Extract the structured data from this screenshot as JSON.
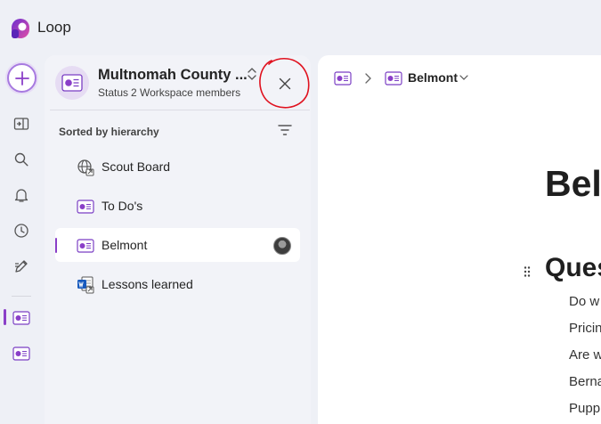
{
  "app": {
    "title": "Loop"
  },
  "rail": {
    "items": [
      {
        "name": "new",
        "icon": "plus-icon"
      },
      {
        "name": "panel-toggle",
        "icon": "panel-toggle-icon"
      },
      {
        "name": "search",
        "icon": "search-icon"
      },
      {
        "name": "notifications",
        "icon": "bell-icon"
      },
      {
        "name": "recent",
        "icon": "clock-icon"
      },
      {
        "name": "ideas",
        "icon": "pen-icon"
      },
      {
        "name": "workspace-1",
        "icon": "loop-page-icon"
      },
      {
        "name": "workspace-2",
        "icon": "loop-page-icon"
      }
    ]
  },
  "workspace": {
    "title": "Multnomah County ...",
    "status": "Status",
    "members": "2 Workspace members"
  },
  "tree": {
    "sort_label": "Sorted by hierarchy",
    "items": [
      {
        "label": "Scout Board",
        "icon": "globe-link-icon"
      },
      {
        "label": "To Do's",
        "icon": "loop-page-icon"
      },
      {
        "label": "Belmont",
        "icon": "loop-page-icon",
        "selected": true
      },
      {
        "label": "Lessons learned",
        "icon": "word-doc-link-icon"
      }
    ]
  },
  "breadcrumb": {
    "current": "Belmont"
  },
  "document": {
    "title": "Beln",
    "heading": "Ques",
    "lines": [
      "Do w",
      "Pricin",
      "Are w",
      "Berna",
      "Pupp"
    ]
  },
  "colors": {
    "accent": "#8a3fc8",
    "annotation": "#e0121f"
  }
}
